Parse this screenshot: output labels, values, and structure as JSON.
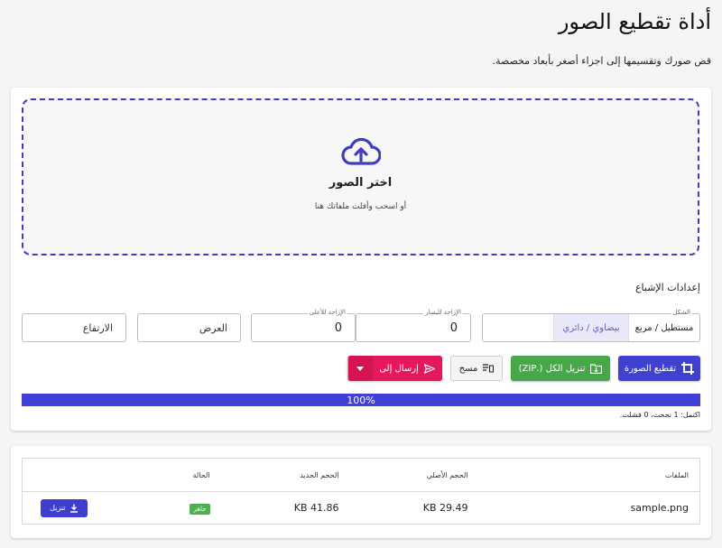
{
  "header": {
    "title": "أداة تقطيع الصور",
    "subtitle": "قص صورك وتقسيمها إلى اجزاء أصغر بأبعاد مخصصة."
  },
  "dropzone": {
    "title": "اختر الصور",
    "subtitle": "أو اسحب وأفلت ملفاتك هنا",
    "icon": "cloud-upload-icon"
  },
  "settings": {
    "title": "إعدادات الإشباع",
    "shape": {
      "label": "الشكل",
      "options": [
        "مستطيل / مربع",
        "بيضاوي / دائري"
      ],
      "selected": "بيضاوي / دائري"
    },
    "offset_x": {
      "label": "الإزاحة لليسار",
      "value": "0"
    },
    "offset_y": {
      "label": "الإزاحة للأعلى",
      "value": "0"
    },
    "width": {
      "placeholder": "العرض"
    },
    "height": {
      "placeholder": "الارتفاع"
    }
  },
  "actions": {
    "crop": "تقطيع الصورة",
    "zip": "تنزيل الكل (.ZIP)",
    "clear": "مسح",
    "send": "إرسال إلى"
  },
  "progress": {
    "percent": 100,
    "label": "100%",
    "status": "اكتمل: 1 نجحت، 0 فشلت."
  },
  "table": {
    "headers": [
      "الملفات",
      "الحجم الأصلي",
      "الحجم الجديد",
      "الحالة",
      ""
    ],
    "rows": [
      {
        "file": "sample.png",
        "original_size": "KB 29.49",
        "new_size": "KB 41.86",
        "status": "جاهز",
        "action": "تنزيل"
      }
    ]
  },
  "colors": {
    "accent": "#4141cf",
    "success": "#46a849",
    "danger": "#e6185d"
  }
}
